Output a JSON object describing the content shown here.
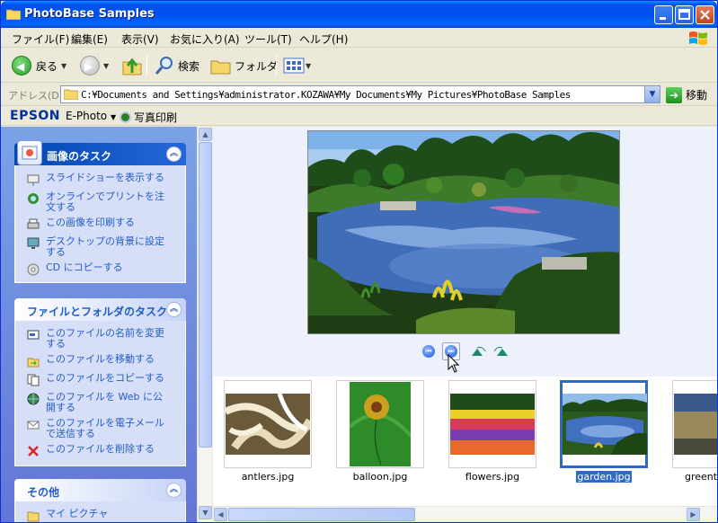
{
  "window": {
    "title": "PhotoBase Samples"
  },
  "menu": [
    "ファイル(F)",
    "編集(E)",
    "表示(V)",
    "お気に入り(A)",
    "ツール(T)",
    "ヘルプ(H)"
  ],
  "toolbar": {
    "back": "戻る",
    "search": "検索",
    "folders": "フォルダ"
  },
  "address": {
    "label": "アドレス(D)",
    "path": "C:¥Documents and Settings¥administrator.KOZAWA¥My Documents¥My Pictures¥PhotoBase Samples",
    "go": "移動"
  },
  "epsonbar": {
    "brand": "EPSON",
    "ephoto": "E-Photo",
    "print": "写真印刷"
  },
  "tasks": {
    "image": {
      "title": "画像のタスク",
      "items": [
        "スライドショーを表示する",
        "オンラインでプリントを注文する",
        "この画像を印刷する",
        "デスクトップの背景に設定する",
        "CD にコピーする"
      ]
    },
    "file": {
      "title": "ファイルとフォルダのタスク",
      "items": [
        "このファイルの名前を変更する",
        "このファイルを移動する",
        "このファイルをコピーする",
        "このファイルを Web に公開する",
        "このファイルを電子メールで送信する",
        "このファイルを削除する"
      ]
    },
    "other": {
      "title": "その他",
      "items": [
        "マイ ピクチャ"
      ]
    }
  },
  "thumbnails": [
    {
      "name": "antlers.jpg",
      "selected": false
    },
    {
      "name": "balloon.jpg",
      "selected": false
    },
    {
      "name": "flowers.jpg",
      "selected": false
    },
    {
      "name": "garden.jpg",
      "selected": true
    },
    {
      "name": "greentr",
      "selected": false
    }
  ],
  "colors": {
    "titlebar": "#0054e3",
    "taskpane": "#6f8cde",
    "selection": "#316ac5",
    "link": "#215dc6"
  }
}
